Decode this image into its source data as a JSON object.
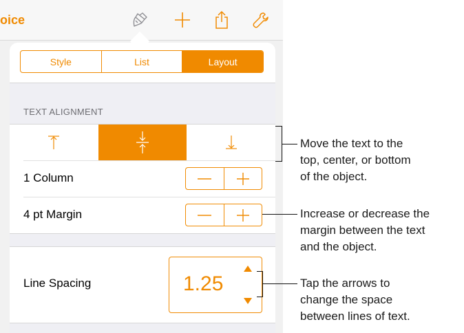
{
  "toolbar": {
    "doc_title": "oice",
    "icons": [
      "paintbrush-icon",
      "plus-icon",
      "share-icon",
      "wrench-icon"
    ],
    "accent": "#f08a00"
  },
  "tabs": [
    {
      "label": "Style",
      "active": false
    },
    {
      "label": "List",
      "active": false
    },
    {
      "label": "Layout",
      "active": true
    }
  ],
  "text_alignment": {
    "header": "TEXT ALIGNMENT",
    "options": [
      {
        "icon": "align-top-icon",
        "active": false
      },
      {
        "icon": "align-middle-icon",
        "active": true
      },
      {
        "icon": "align-bottom-icon",
        "active": false
      }
    ]
  },
  "columns": {
    "label": "1 Column"
  },
  "margin": {
    "label": "4 pt Margin"
  },
  "line_spacing": {
    "label": "Line Spacing",
    "value": "1.25"
  },
  "callouts": {
    "alignment": "Move the text to the\ntop, center, or bottom\nof the object.",
    "margin": "Increase or decrease the\nmargin between the text\nand the object.",
    "spacing": "Tap the arrows to\nchange the space\nbetween lines of text."
  }
}
